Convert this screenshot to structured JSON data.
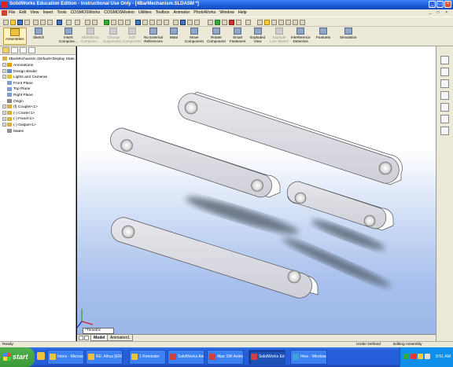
{
  "window": {
    "title": "SolidWorks Education Edition - Instructional Use Only - [4BarMechanism.SLDASM *]"
  },
  "menu": [
    "File",
    "Edit",
    "View",
    "Insert",
    "Tools",
    "COSMOSWorks",
    "COSMOSMotion",
    "Utilities",
    "Toolbox",
    "Animator",
    "PhotoWorks",
    "Window",
    "Help"
  ],
  "commands": {
    "assemblies": "Assemblies",
    "sketch": "Sketch",
    "insert_components": [
      "Insert",
      "Compone..."
    ],
    "hide_show": [
      "Hide/Show",
      "Compone..."
    ],
    "change_suppression": [
      "Change",
      "Suppressio..."
    ],
    "edit_component": [
      "Edit",
      "Component"
    ],
    "no_external_refs": [
      "No External",
      "References"
    ],
    "mate": "Mate",
    "move_component": [
      "Move",
      "Component"
    ],
    "rotate_component": [
      "Rotate",
      "Component"
    ],
    "smart_fasteners": [
      "Smart",
      "Fasteners"
    ],
    "exploded_view": [
      "Exploded",
      "View"
    ],
    "explode_line_sketch": [
      "Explode",
      "Line Sketch"
    ],
    "interference_detection": [
      "Interference",
      "Detection"
    ],
    "features": "Features",
    "simulation": "Simulation"
  },
  "tree": {
    "root": "4BarMechanism  (Default<Display State",
    "items": [
      {
        "label": "Annotations",
        "expander": "+",
        "icon": "annotations-icon",
        "color": "#e0a000"
      },
      {
        "label": "Design Binder",
        "expander": "+",
        "icon": "design-binder-icon",
        "color": "#6a8ac8"
      },
      {
        "label": "Lights and Cameras",
        "expander": "+",
        "icon": "lights-cameras-icon",
        "color": "#e8c020"
      },
      {
        "label": "Front Plane",
        "expander": "",
        "icon": "plane-icon",
        "color": "#7aa0d0"
      },
      {
        "label": "Top Plane",
        "expander": "",
        "icon": "plane-icon",
        "color": "#7aa0d0"
      },
      {
        "label": "Right Plane",
        "expander": "",
        "icon": "plane-icon",
        "color": "#7aa0d0"
      },
      {
        "label": "Origin",
        "expander": "",
        "icon": "origin-icon",
        "color": "#888888"
      },
      {
        "label": "(f) Coupler<1>",
        "expander": "+",
        "icon": "part-icon",
        "color": "#d8b040"
      },
      {
        "label": "(-) Crank<1>",
        "expander": "+",
        "icon": "part-icon",
        "color": "#d8b040"
      },
      {
        "label": "(-) Fixed<1>",
        "expander": "+",
        "icon": "part-icon",
        "color": "#d8b040"
      },
      {
        "label": "(-) Output<1>",
        "expander": "+",
        "icon": "part-icon",
        "color": "#d8b040"
      },
      {
        "label": "Mates",
        "expander": "",
        "icon": "mates-icon",
        "color": "#909090"
      }
    ]
  },
  "viewport": {
    "view_orientation": "*Trimetric"
  },
  "tabs": {
    "model": "Model",
    "animation": "Animation1"
  },
  "status": {
    "left": "Ready",
    "center": "Under Defined",
    "right": "Editing Assembly"
  },
  "taskbar": {
    "start": "start",
    "tasks": [
      {
        "label": "Inbox - Microsof...",
        "icon_color": "#f0c040",
        "active": false
      },
      {
        "label": "RE: Alhus [ERG...",
        "icon_color": "#f0c040",
        "active": false
      },
      {
        "label": "1 Reminder",
        "icon_color": "#f0c040",
        "active": false
      },
      {
        "label": "SolidWorks Anim...",
        "icon_color": "#d04040",
        "active": false
      },
      {
        "label": "4bar SW Animati...",
        "icon_color": "#d04040",
        "active": false
      },
      {
        "label": "SolidWorks Educ...",
        "icon_color": "#d04040",
        "active": true
      },
      {
        "label": "Hew - Windows ...",
        "icon_color": "#40a0e0",
        "active": false
      }
    ],
    "clock": "9:51 AM"
  }
}
